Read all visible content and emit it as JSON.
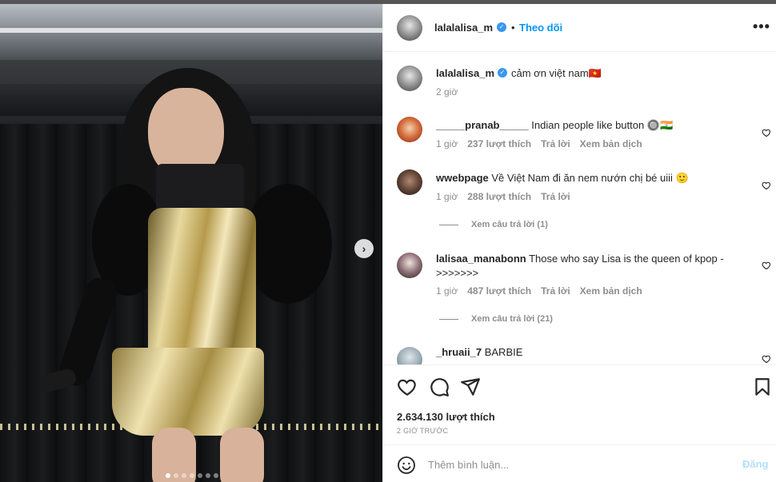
{
  "post": {
    "username": "lalalalisa_m",
    "follow_label": "Theo dõi",
    "follow_separator": "•",
    "more_label": "•••",
    "caption": "cảm ơn việt nam🇻🇳",
    "caption_time": "2 giờ",
    "next_label": "›",
    "dots_total": 7,
    "dots_active": 0,
    "likes": "2.634.130 lượt thích",
    "time_ago": "2 GIỜ TRƯỚC"
  },
  "comments": [
    {
      "username": "_____pranab_____",
      "text": "Indian people like button 🔘🇮🇳",
      "time": "1 giờ",
      "likes": "237 lượt thích",
      "reply": "Trả lời",
      "translate": "Xem bản dịch"
    },
    {
      "username": "wwebpage",
      "text": "Về Việt Nam đi ăn nem nướn chị bé uiii 🙂",
      "time": "1 giờ",
      "likes": "288 lượt thích",
      "reply": "Trả lời",
      "view_replies": "Xem câu trả lời (1)"
    },
    {
      "username": "lalisaa_manabonn",
      "text": "Those who say Lisa is the queen of kpop -",
      "text2": ">>>>>>>",
      "time": "1 giờ",
      "likes": "487 lượt thích",
      "reply": "Trả lời",
      "translate": "Xem bản dịch",
      "view_replies": "Xem câu trả lời (21)"
    },
    {
      "username": "_hruaii_7",
      "text": "BARBIE"
    }
  ],
  "composer": {
    "placeholder": "Thêm bình luận...",
    "post_label": "Đăng"
  },
  "icons": {
    "verified": "verified-badge",
    "like": "heart-icon",
    "comment": "comment-icon",
    "share": "share-icon",
    "save": "bookmark-icon",
    "emoji": "emoji-icon",
    "next": "chevron-right-icon"
  },
  "colors": {
    "accent": "#0095f6",
    "verified": "#3897f0",
    "muted": "#8e8e8e",
    "text": "#262626",
    "post_disabled": "#b2dffc"
  }
}
